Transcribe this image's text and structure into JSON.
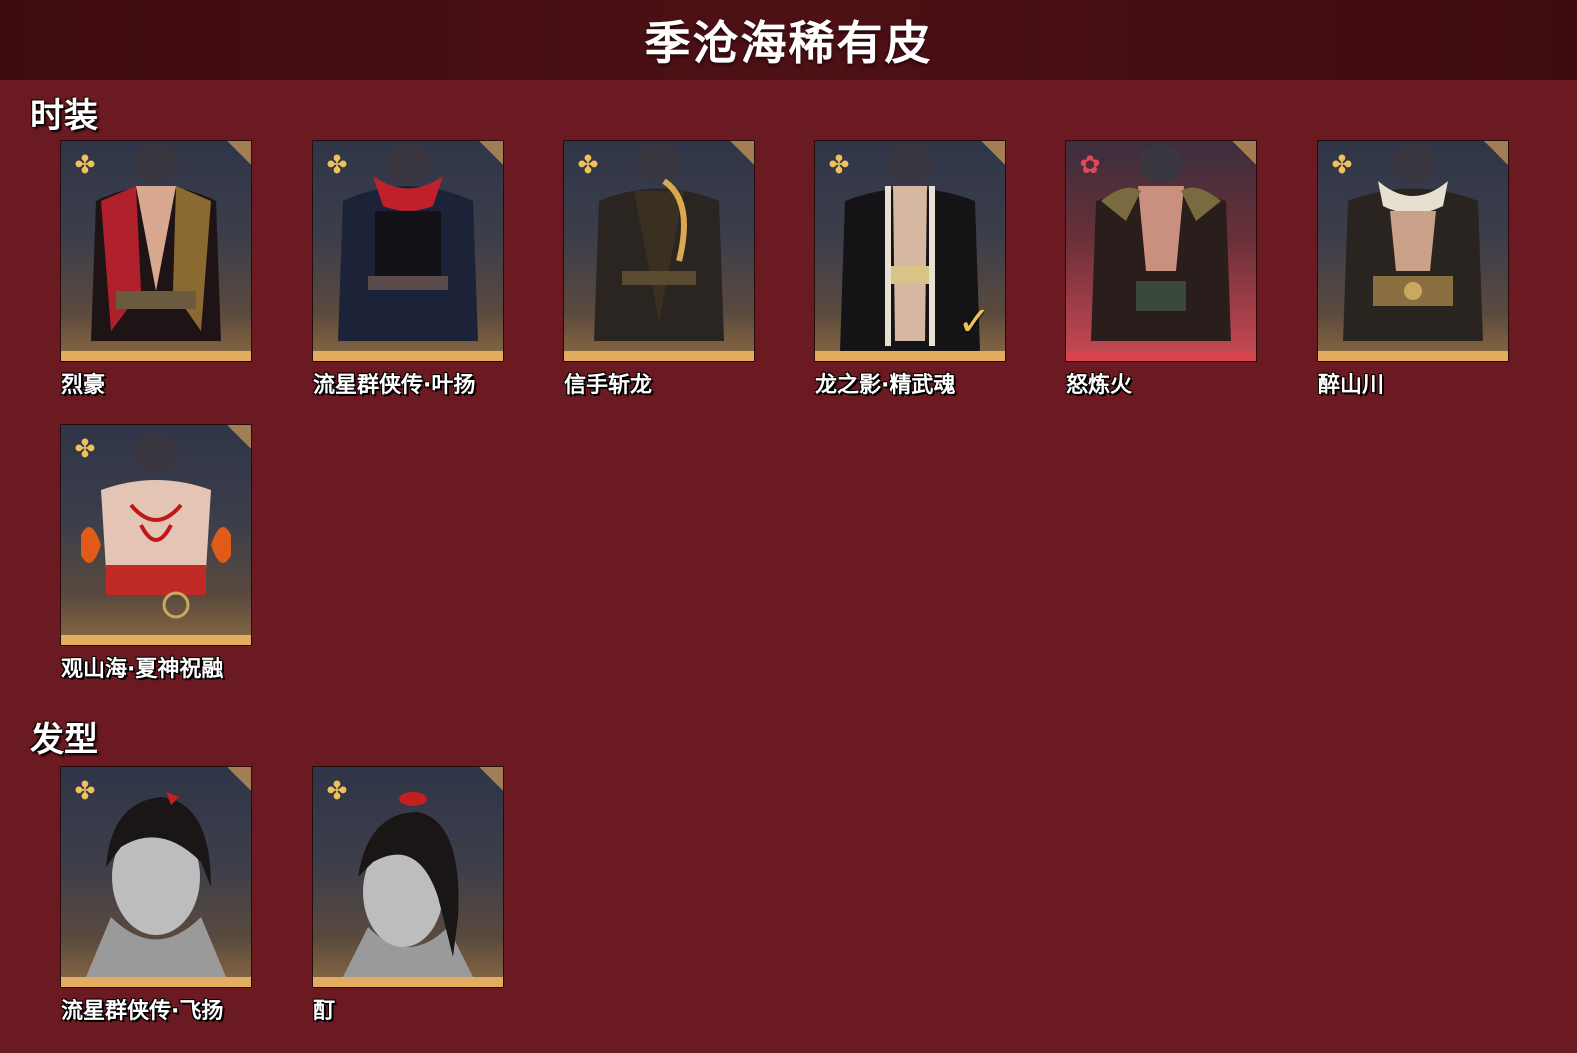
{
  "header": {
    "title": "季沧海稀有皮"
  },
  "sections": [
    {
      "title": "时装",
      "items": [
        {
          "label": "烈豪",
          "rarity_icon": "gold-flower-icon",
          "accent": "#e2ad61",
          "outfit_color": "#b0202a",
          "owned": false
        },
        {
          "label": "流星群侠传·叶扬",
          "rarity_icon": "gold-flower-icon",
          "accent": "#e2ad61",
          "outfit_color": "#1c2238",
          "owned": false
        },
        {
          "label": "信手斩龙",
          "rarity_icon": "gold-flower-icon",
          "accent": "#e2ad61",
          "outfit_color": "#3a3020",
          "owned": false
        },
        {
          "label": "龙之影·精武魂",
          "rarity_icon": "gold-flower-icon",
          "accent": "#e2ad61",
          "outfit_color": "#1a1a1e",
          "owned": true
        },
        {
          "label": "怒炼火",
          "rarity_icon": "red-flower-icon",
          "accent": "#d7464f",
          "outfit_color": "#2a1e1c",
          "owned": false
        },
        {
          "label": "醉山川",
          "rarity_icon": "gold-flower-icon",
          "accent": "#e2ad61",
          "outfit_color": "#3a3224",
          "owned": false
        },
        {
          "label": "观山海·夏神祝融",
          "rarity_icon": "gold-flower-icon",
          "accent": "#e2ad61",
          "outfit_color": "#c02a24",
          "owned": false
        }
      ]
    },
    {
      "title": "发型",
      "items": [
        {
          "label": "流星群侠传·飞扬",
          "rarity_icon": "gold-flower-icon",
          "accent": "#e2ad61",
          "owned": false
        },
        {
          "label": "酊",
          "rarity_icon": "gold-flower-icon",
          "accent": "#e2ad61",
          "owned": false
        }
      ]
    }
  ]
}
